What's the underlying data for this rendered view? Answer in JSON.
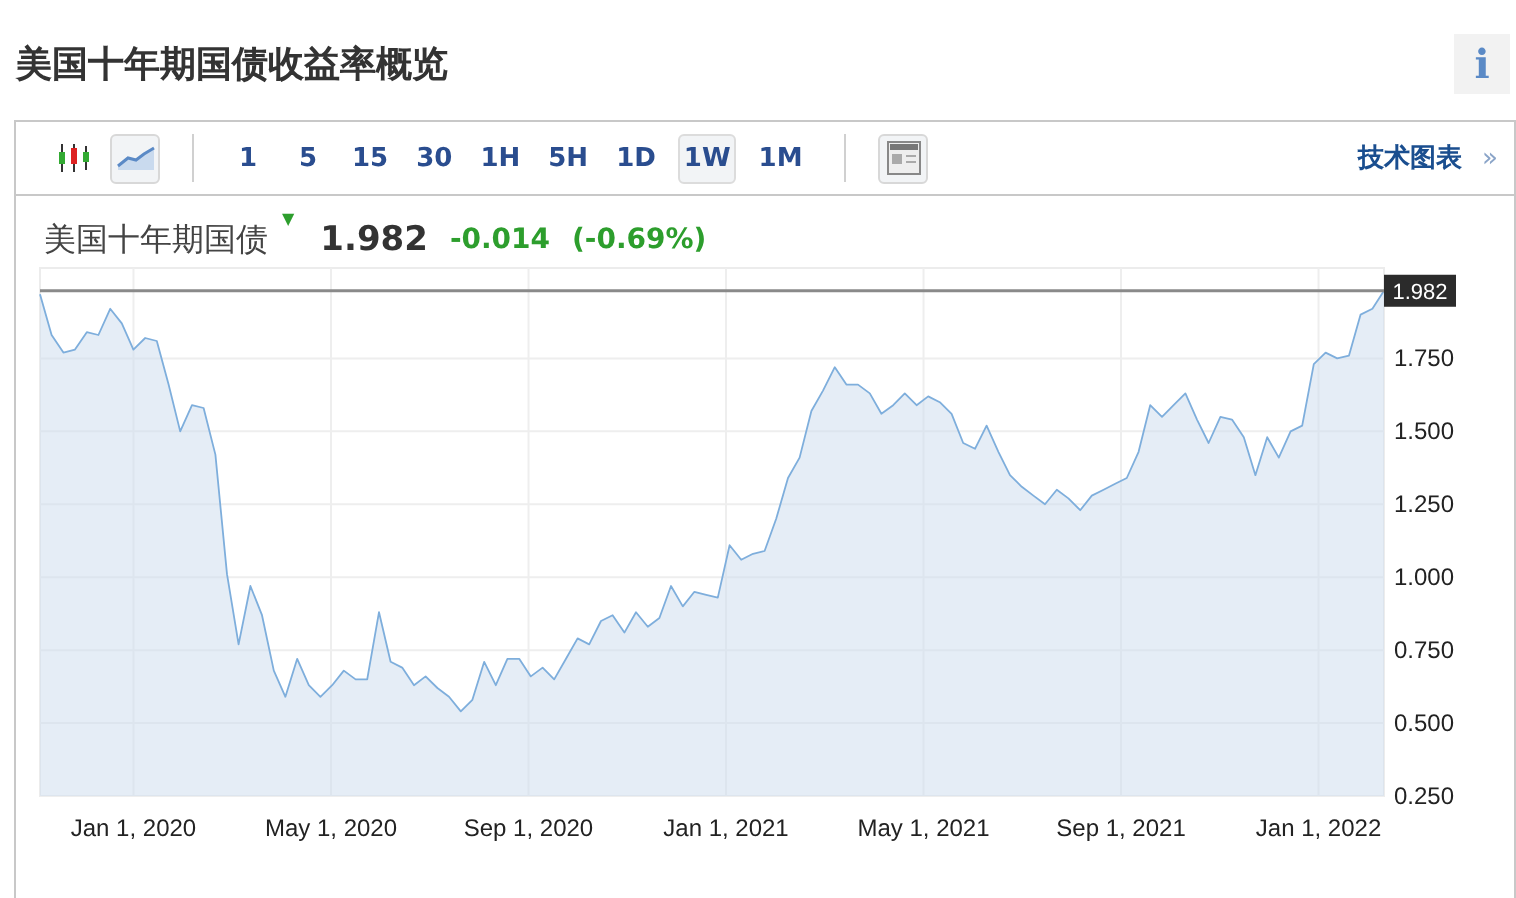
{
  "title": "美国十年期国债收益率概览",
  "info_button": "i",
  "toolbar": {
    "chart_types": [
      {
        "kind": "candlestick",
        "selected": false
      },
      {
        "kind": "line",
        "selected": true
      }
    ],
    "intervals": [
      {
        "label": "1",
        "selected": false
      },
      {
        "label": "5",
        "selected": false
      },
      {
        "label": "15",
        "selected": false
      },
      {
        "label": "30",
        "selected": false
      },
      {
        "label": "1H",
        "selected": false
      },
      {
        "label": "5H",
        "selected": false
      },
      {
        "label": "1D",
        "selected": false
      },
      {
        "label": "1W",
        "selected": true
      },
      {
        "label": "1M",
        "selected": false
      }
    ],
    "link": "技术图表",
    "link_arrow": "»"
  },
  "quote": {
    "name": "美国十年期国债",
    "arrow": "▼",
    "price": "1.982",
    "change": "-0.014",
    "change_pct": "(-0.69%)"
  },
  "chart": {
    "current_label": "1.982",
    "x_labels": [
      "Jan 1, 2020",
      "May 1, 2020",
      "Sep 1, 2020",
      "Jan 1, 2021",
      "May 1, 2021",
      "Sep 1, 2021",
      "Jan 1, 2022"
    ],
    "chart_data": {
      "type": "area",
      "grid": true,
      "ylim": [
        0.25,
        2.06
      ],
      "yticks": [
        {
          "value": 0.25,
          "label": "0.250"
        },
        {
          "value": 0.5,
          "label": "0.500"
        },
        {
          "value": 0.75,
          "label": "0.750"
        },
        {
          "value": 1,
          "label": "1.000"
        },
        {
          "value": 1.25,
          "label": "1.250"
        },
        {
          "value": 1.5,
          "label": "1.500"
        },
        {
          "value": 1.75,
          "label": "1.750"
        }
      ],
      "series": [
        {
          "color": "#7eaedc",
          "values": [
            1.97,
            1.83,
            1.77,
            1.78,
            1.84,
            1.83,
            1.92,
            1.87,
            1.78,
            1.82,
            1.81,
            1.66,
            1.5,
            1.59,
            1.58,
            1.42,
            1.01,
            0.77,
            0.97,
            0.87,
            0.68,
            0.59,
            0.72,
            0.63,
            0.59,
            0.63,
            0.68,
            0.65,
            0.65,
            0.88,
            0.71,
            0.69,
            0.63,
            0.66,
            0.62,
            0.59,
            0.54,
            0.58,
            0.71,
            0.63,
            0.72,
            0.72,
            0.66,
            0.69,
            0.65,
            0.72,
            0.79,
            0.77,
            0.85,
            0.87,
            0.81,
            0.88,
            0.83,
            0.86,
            0.97,
            0.9,
            0.95,
            0.94,
            0.93,
            1.11,
            1.06,
            1.08,
            1.09,
            1.2,
            1.34,
            1.41,
            1.57,
            1.64,
            1.72,
            1.66,
            1.66,
            1.63,
            1.56,
            1.59,
            1.63,
            1.59,
            1.62,
            1.6,
            1.56,
            1.46,
            1.44,
            1.52,
            1.43,
            1.35,
            1.31,
            1.28,
            1.25,
            1.3,
            1.27,
            1.23,
            1.28,
            1.3,
            1.32,
            1.34,
            1.43,
            1.59,
            1.55,
            1.59,
            1.63,
            1.54,
            1.46,
            1.55,
            1.54,
            1.48,
            1.35,
            1.48,
            1.41,
            1.5,
            1.52,
            1.73,
            1.77,
            1.75,
            1.76,
            1.9,
            1.92,
            1.982
          ]
        }
      ]
    }
  }
}
